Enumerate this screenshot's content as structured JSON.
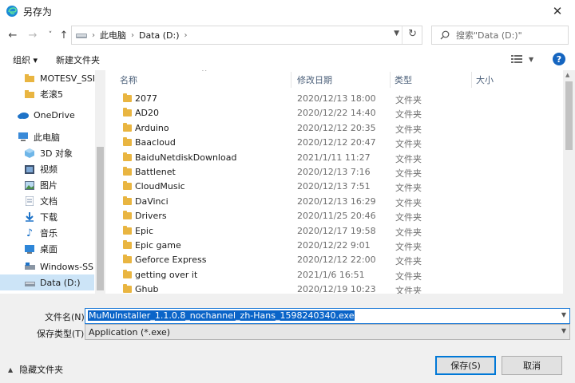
{
  "window": {
    "title": "另存为"
  },
  "nav": {
    "back": "←",
    "forward": "→",
    "recent": "˅",
    "up": "↑",
    "breadcrumb": [
      "此电脑",
      "Data (D:)"
    ],
    "search_placeholder": "搜索\"Data (D:)\""
  },
  "toolbar": {
    "organize": "组织 ▾",
    "new_folder": "新建文件夹"
  },
  "sidebar": {
    "items": [
      {
        "label": "MOTESV_SSE",
        "icon": "folder-icon"
      },
      {
        "label": "老滚5",
        "icon": "folder-icon"
      },
      {
        "label": "OneDrive",
        "icon": "cloud-icon"
      },
      {
        "label": "此电脑",
        "icon": "computer-icon"
      },
      {
        "label": "3D 对象",
        "icon": "cube-icon"
      },
      {
        "label": "视频",
        "icon": "video-icon"
      },
      {
        "label": "图片",
        "icon": "image-icon"
      },
      {
        "label": "文档",
        "icon": "document-icon"
      },
      {
        "label": "下载",
        "icon": "download-icon"
      },
      {
        "label": "音乐",
        "icon": "music-icon"
      },
      {
        "label": "桌面",
        "icon": "desktop-icon"
      },
      {
        "label": "Windows-SSD (",
        "icon": "drive-icon"
      },
      {
        "label": "Data (D:)",
        "icon": "drive-icon",
        "selected": true
      }
    ]
  },
  "columns": {
    "name": "名称",
    "modified": "修改日期",
    "type": "类型",
    "size": "大小"
  },
  "files": [
    {
      "name": "2077",
      "date": "2020/12/13 18:00",
      "type": "文件夹"
    },
    {
      "name": "AD20",
      "date": "2020/12/22 14:40",
      "type": "文件夹"
    },
    {
      "name": "Arduino",
      "date": "2020/12/12 20:35",
      "type": "文件夹"
    },
    {
      "name": "Baacloud",
      "date": "2020/12/12 20:47",
      "type": "文件夹"
    },
    {
      "name": "BaiduNetdiskDownload",
      "date": "2021/1/11 11:27",
      "type": "文件夹"
    },
    {
      "name": "Battlenet",
      "date": "2020/12/13 7:16",
      "type": "文件夹"
    },
    {
      "name": "CloudMusic",
      "date": "2020/12/13 7:51",
      "type": "文件夹"
    },
    {
      "name": "DaVinci",
      "date": "2020/12/13 16:29",
      "type": "文件夹"
    },
    {
      "name": "Drivers",
      "date": "2020/11/25 20:46",
      "type": "文件夹"
    },
    {
      "name": "Epic",
      "date": "2020/12/17 19:58",
      "type": "文件夹"
    },
    {
      "name": "Epic game",
      "date": "2020/12/22 9:01",
      "type": "文件夹"
    },
    {
      "name": "Geforce Express",
      "date": "2020/12/12 22:00",
      "type": "文件夹"
    },
    {
      "name": "getting over it",
      "date": "2021/1/6 16:51",
      "type": "文件夹"
    },
    {
      "name": "Ghub",
      "date": "2020/12/19 10:23",
      "type": "文件夹"
    }
  ],
  "save": {
    "filename_label": "文件名(N):",
    "filename_value": "MuMuInstaller_1.1.0.8_nochannel_zh-Hans_1598240340.exe",
    "type_label": "保存类型(T):",
    "type_value": "Application (*.exe)",
    "hide_folders": "隐藏文件夹",
    "save_button": "保存(S)",
    "cancel_button": "取消"
  },
  "colors": {
    "accent": "#0078d7",
    "selection": "#cce4f7",
    "folder": "#e9b541"
  }
}
